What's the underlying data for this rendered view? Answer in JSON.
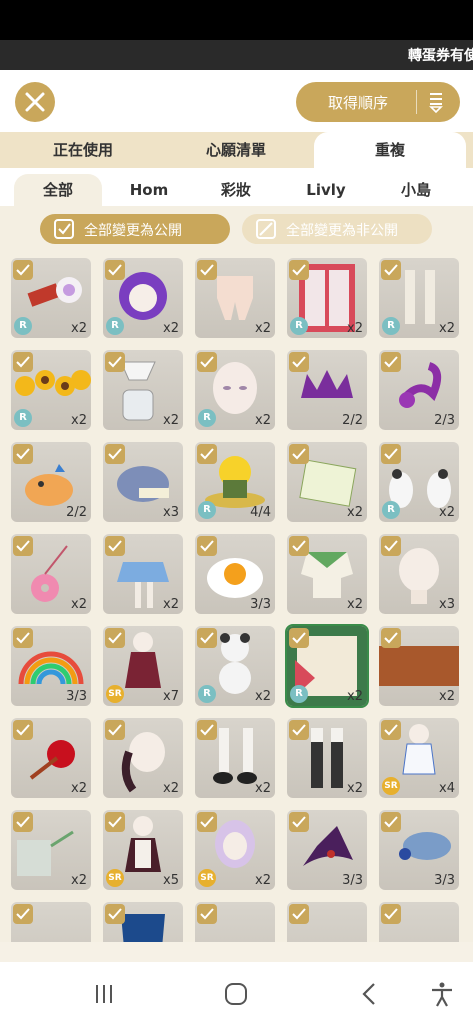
{
  "ticker": {
    "text": "轉蛋券有使"
  },
  "header": {
    "sort_label": "取得順序"
  },
  "tabs_primary": [
    {
      "label": "正在使用"
    },
    {
      "label": "心願清單"
    },
    {
      "label": "重複"
    }
  ],
  "tabs_secondary": [
    {
      "label": "全部"
    },
    {
      "label": "Hom"
    },
    {
      "label": "彩妝"
    },
    {
      "label": "Livly"
    },
    {
      "label": "小島"
    }
  ],
  "actions": {
    "make_public": "全部變更為公開",
    "make_private": "全部變更為非公開"
  },
  "items": [
    {
      "art": "scroll-potion-icon",
      "rarity": "R",
      "count": "x2"
    },
    {
      "art": "purple-hair-icon",
      "rarity": "R",
      "count": "x2"
    },
    {
      "art": "ruffle-pants-icon",
      "rarity": "",
      "count": "x2"
    },
    {
      "art": "red-window-icon",
      "rarity": "R",
      "count": "x2"
    },
    {
      "art": "white-socks-icon",
      "rarity": "R",
      "count": "x2"
    },
    {
      "art": "sunflowers-icon",
      "rarity": "R",
      "count": "x2"
    },
    {
      "art": "coffee-dripper-icon",
      "rarity": "",
      "count": "x2"
    },
    {
      "art": "face-icon",
      "rarity": "R",
      "count": "x2"
    },
    {
      "art": "purple-crown-icon",
      "rarity": "",
      "count": "2/2"
    },
    {
      "art": "scorpion-icon",
      "rarity": "",
      "count": "2/3"
    },
    {
      "art": "shiba-pet-icon",
      "rarity": "",
      "count": "2/2"
    },
    {
      "art": "blue-shell-icon",
      "rarity": "",
      "count": "x3"
    },
    {
      "art": "flower-hat-icon",
      "rarity": "R",
      "count": "4/4"
    },
    {
      "art": "certificate-icon",
      "rarity": "",
      "count": "x2"
    },
    {
      "art": "panda-slippers-icon",
      "rarity": "R",
      "count": "x2"
    },
    {
      "art": "donut-bag-icon",
      "rarity": "",
      "count": "x2"
    },
    {
      "art": "plaid-skirt-icon",
      "rarity": "",
      "count": "x2"
    },
    {
      "art": "fried-egg-icon",
      "rarity": "",
      "count": "3/3"
    },
    {
      "art": "green-jacket-icon",
      "rarity": "",
      "count": "x2"
    },
    {
      "art": "bald-head-icon",
      "rarity": "",
      "count": "x3"
    },
    {
      "art": "rainbow-icon",
      "rarity": "",
      "count": "3/3"
    },
    {
      "art": "gothic-dress-icon",
      "rarity": "SR",
      "count": "x7"
    },
    {
      "art": "panda-stack-icon",
      "rarity": "R",
      "count": "x2"
    },
    {
      "art": "cake-shelf-icon",
      "rarity": "R",
      "count": "x2"
    },
    {
      "art": "brown-rug-icon",
      "rarity": "",
      "count": "x2"
    },
    {
      "art": "red-flower-icon",
      "rarity": "",
      "count": "x2"
    },
    {
      "art": "curly-hair-icon",
      "rarity": "",
      "count": "x2"
    },
    {
      "art": "black-shoes-icon",
      "rarity": "",
      "count": "x2"
    },
    {
      "art": "striped-socks-icon",
      "rarity": "",
      "count": "x2"
    },
    {
      "art": "sailor-outfit-icon",
      "rarity": "SR",
      "count": "x4"
    },
    {
      "art": "watering-can-icon",
      "rarity": "",
      "count": "x2"
    },
    {
      "art": "maid-dress-icon",
      "rarity": "SR",
      "count": "x5"
    },
    {
      "art": "lavender-hair-icon",
      "rarity": "SR",
      "count": "x2"
    },
    {
      "art": "witch-hat-icon",
      "rarity": "",
      "count": "3/3"
    },
    {
      "art": "blue-beret-icon",
      "rarity": "",
      "count": "3/3"
    },
    {
      "art": "white-lace-icon",
      "rarity": "",
      "count": ""
    },
    {
      "art": "blue-bucket-icon",
      "rarity": "",
      "count": ""
    },
    {
      "art": "yellow-bush-icon",
      "rarity": "",
      "count": ""
    },
    {
      "art": "cream-hat-icon",
      "rarity": "",
      "count": ""
    },
    {
      "art": "pink-mushroom-icon",
      "rarity": "",
      "count": ""
    }
  ]
}
